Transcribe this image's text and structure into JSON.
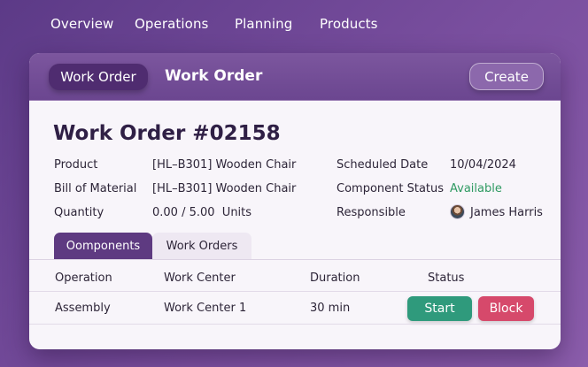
{
  "topnav": {
    "items": [
      "Overview",
      "Operations",
      "Planning",
      "Products"
    ]
  },
  "header": {
    "breadcrumb_label": "Work Order",
    "title": "Work Order",
    "create_label": "Create"
  },
  "work_order": {
    "title": "Work Order #02158",
    "fields_left": [
      {
        "label": "Product",
        "value": "[HL–B301] Wooden Chair"
      },
      {
        "label": "Bill of Material",
        "value": "[HL–B301] Wooden Chair"
      },
      {
        "label": "Quantity",
        "value": "0.00 / 5.00  Units"
      }
    ],
    "fields_right": [
      {
        "label": "Scheduled Date",
        "value": "10/04/2024"
      },
      {
        "label": "Component Status",
        "value": "Available"
      },
      {
        "label": "Responsible",
        "value": "James Harris"
      }
    ]
  },
  "tabs": [
    "Oomponents",
    "Work Orders"
  ],
  "table": {
    "columns": [
      "Operation",
      "Work Center",
      "Duration",
      "Status"
    ],
    "rows": [
      {
        "operation": "Assembly",
        "work_center": "Work Center 1",
        "duration": "30 min",
        "start_label": "Start",
        "block_label": "Block"
      }
    ]
  },
  "colors": {
    "accent": "#6b4690",
    "available": "#2f9a62",
    "start": "#2f9a7c",
    "block": "#d6496b"
  }
}
